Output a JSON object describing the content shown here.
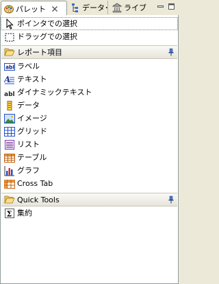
{
  "tabs": [
    {
      "label": "パレット",
      "icon": "palette-icon"
    },
    {
      "label": "データ･",
      "icon": "data-tree-icon"
    },
    {
      "label": "ライブ",
      "icon": "library-icon"
    }
  ],
  "tools": [
    {
      "label": "ポインタでの選択",
      "icon": "pointer-arrow-icon"
    },
    {
      "label": "ドラッグでの選択",
      "icon": "marquee-select-icon"
    }
  ],
  "drawers": [
    {
      "label": "レポート項目",
      "items": [
        {
          "label": "ラベル",
          "icon": "label-icon"
        },
        {
          "label": "テキスト",
          "icon": "text-icon"
        },
        {
          "label": "ダイナミックテキスト",
          "icon": "dynamic-text-icon"
        },
        {
          "label": "データ",
          "icon": "data-icon"
        },
        {
          "label": "イメージ",
          "icon": "image-icon"
        },
        {
          "label": "グリッド",
          "icon": "grid-icon"
        },
        {
          "label": "リスト",
          "icon": "list-icon"
        },
        {
          "label": "テーブル",
          "icon": "table-icon"
        },
        {
          "label": "グラフ",
          "icon": "chart-icon"
        },
        {
          "label": "Cross Tab",
          "icon": "crosstab-icon"
        }
      ]
    },
    {
      "label": "Quick Tools",
      "items": [
        {
          "label": "集約",
          "icon": "sigma-aggregation-icon"
        }
      ]
    }
  ],
  "colors": {
    "accent": "#316ac5",
    "folder": "#f5d66b",
    "panel_bg": "#ffffff",
    "chrome_bg": "#ece9d8"
  }
}
